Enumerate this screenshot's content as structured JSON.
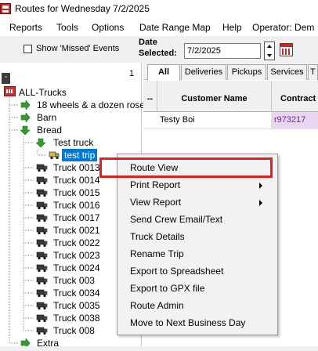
{
  "window": {
    "title": "Routes for Wednesday 7/2/2025"
  },
  "menubar": {
    "items": [
      "Reports",
      "Tools",
      "Options",
      "Date Range Map",
      "Help",
      "Operator: Dem"
    ]
  },
  "toolbar": {
    "missed_label": "Show 'Missed' Events",
    "date_label_line1": "Date",
    "date_label_line2": "Selected:",
    "date_value": "7/2/2025"
  },
  "tree": {
    "count": "1",
    "collapse_symbol": "-",
    "root": "ALL-Trucks",
    "items": [
      "18 wheels & a dozen rose",
      "Barn",
      "Bread",
      "Test truck",
      "test trip",
      "Truck 0013",
      "Truck 0014",
      "Truck 0015",
      "Truck 0016",
      "Truck 0017",
      "Truck 0021",
      "Truck 0022",
      "Truck 0023",
      "Truck 0024",
      "Truck 003",
      "Truck 0034",
      "Truck 0035",
      "Truck 0038",
      "Truck 008",
      "Extra"
    ]
  },
  "tabs": [
    "All",
    "Deliveries",
    "Pickups",
    "Services",
    "T"
  ],
  "grid": {
    "headers": [
      "--",
      "Customer Name",
      "Contract"
    ],
    "rows": [
      {
        "customer": "Testy Boi",
        "contract": "r973217"
      }
    ]
  },
  "context_menu": {
    "items": [
      "Route View",
      "Print Report",
      "View Report",
      "Send Crew Email/Text",
      "Truck Details",
      "Rename Trip",
      "Export to Spreadsheet",
      "Export to GPX file",
      "Route Admin",
      "Move to Next Business Day"
    ]
  },
  "colors": {
    "highlight": "#e01f1f",
    "selection": "#0078d7",
    "contract_bg": "#e8d5f0"
  }
}
